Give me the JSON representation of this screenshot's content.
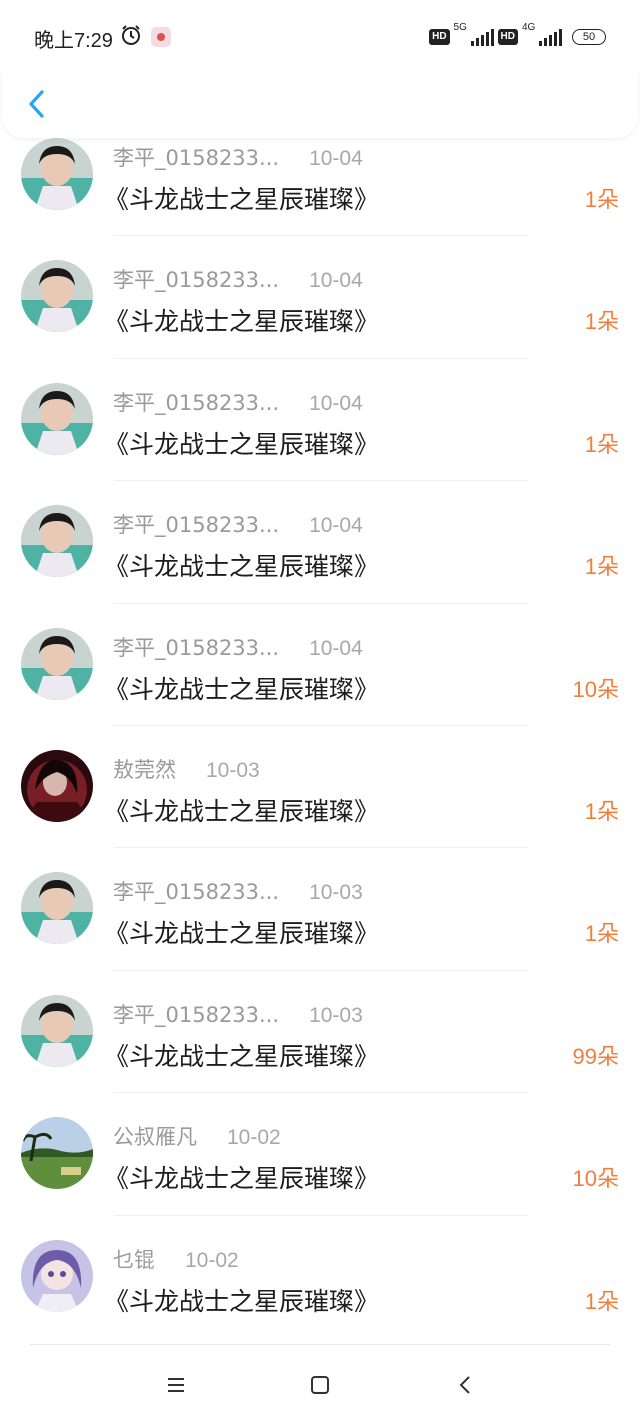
{
  "status": {
    "time": "晚上7:29",
    "network1": "5G",
    "network2": "4G",
    "hd": "HD",
    "battery": "50"
  },
  "header": {
    "back_icon": "chevron-left-icon"
  },
  "rows": [
    {
      "user": "李平_0158233...",
      "date": "10-04",
      "book": "《斗龙战士之星辰璀璨》",
      "count": "1朵",
      "avatar": "girl-photo"
    },
    {
      "user": "李平_0158233...",
      "date": "10-04",
      "book": "《斗龙战士之星辰璀璨》",
      "count": "1朵",
      "avatar": "girl-photo"
    },
    {
      "user": "李平_0158233...",
      "date": "10-04",
      "book": "《斗龙战士之星辰璀璨》",
      "count": "1朵",
      "avatar": "girl-photo"
    },
    {
      "user": "李平_0158233...",
      "date": "10-04",
      "book": "《斗龙战士之星辰璀璨》",
      "count": "1朵",
      "avatar": "girl-photo"
    },
    {
      "user": "李平_0158233...",
      "date": "10-04",
      "book": "《斗龙战士之星辰璀璨》",
      "count": "10朵",
      "avatar": "girl-photo"
    },
    {
      "user": "敖莞然",
      "date": "10-03",
      "book": "《斗龙战士之星辰璀璨》",
      "count": "1朵",
      "avatar": "dark-red-anime"
    },
    {
      "user": "李平_0158233...",
      "date": "10-03",
      "book": "《斗龙战士之星辰璀璨》",
      "count": "1朵",
      "avatar": "girl-photo"
    },
    {
      "user": "李平_0158233...",
      "date": "10-03",
      "book": "《斗龙战士之星辰璀璨》",
      "count": "99朵",
      "avatar": "girl-photo"
    },
    {
      "user": "公叔雁凡",
      "date": "10-02",
      "book": "《斗龙战士之星辰璀璨》",
      "count": "10朵",
      "avatar": "landscape-photo"
    },
    {
      "user": "乜锟",
      "date": "10-02",
      "book": "《斗龙战士之星辰璀璨》",
      "count": "1朵",
      "avatar": "purple-anime"
    }
  ],
  "colors": {
    "count": "#f07f3c",
    "back": "#2aa4f0",
    "muted": "#9a9a9a"
  },
  "navbar": {
    "menu_icon": "menu-icon",
    "home_icon": "square-home-icon",
    "back_icon": "back-triangle-icon"
  }
}
